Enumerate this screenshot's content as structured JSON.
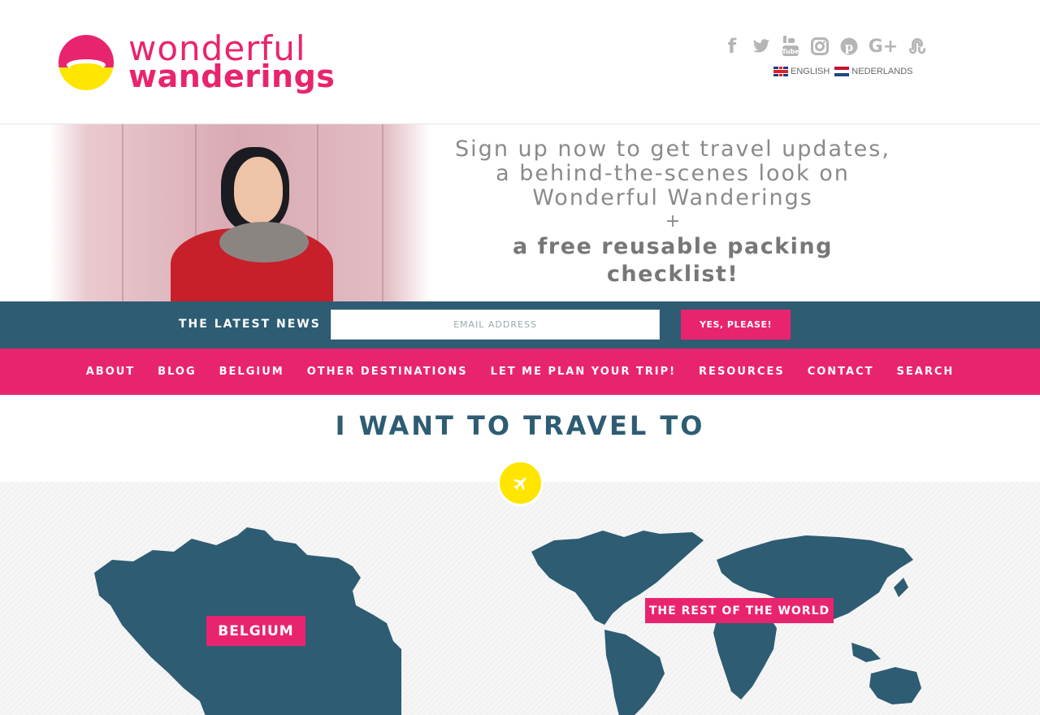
{
  "brand": {
    "line1": "wonderful",
    "line2": "wanderings",
    "color_primary": "#e9246e",
    "color_secondary": "#ffe500",
    "color_dark": "#2d5c73"
  },
  "social_icons": [
    "facebook-icon",
    "twitter-icon",
    "youtube-icon",
    "instagram-icon",
    "pinterest-icon",
    "google-plus-icon",
    "stumbleupon-icon"
  ],
  "languages": [
    {
      "label": "ENGLISH",
      "flag": "uk-flag-icon"
    },
    {
      "label": "NEDERLANDS",
      "flag": "nl-flag-icon"
    }
  ],
  "hero": {
    "line1": "Sign up now to get travel updates,",
    "line2": "a behind-the-scenes look on",
    "line3": "Wonderful Wanderings",
    "plus": "+",
    "bold": "a free reusable packing checklist!"
  },
  "newsletter": {
    "label": "THE LATEST NEWS",
    "placeholder": "EMAIL ADDRESS",
    "button": "YES, PLEASE!"
  },
  "nav": [
    "ABOUT",
    "BLOG",
    "BELGIUM",
    "OTHER DESTINATIONS",
    "LET ME PLAN YOUR TRIP!",
    "RESOURCES",
    "CONTACT",
    "SEARCH"
  ],
  "section": {
    "title": "I WANT TO TRAVEL TO",
    "badge_icon": "airplane-icon"
  },
  "maps": {
    "belgium_label": "BELGIUM",
    "world_label": "THE REST OF THE WORLD"
  }
}
